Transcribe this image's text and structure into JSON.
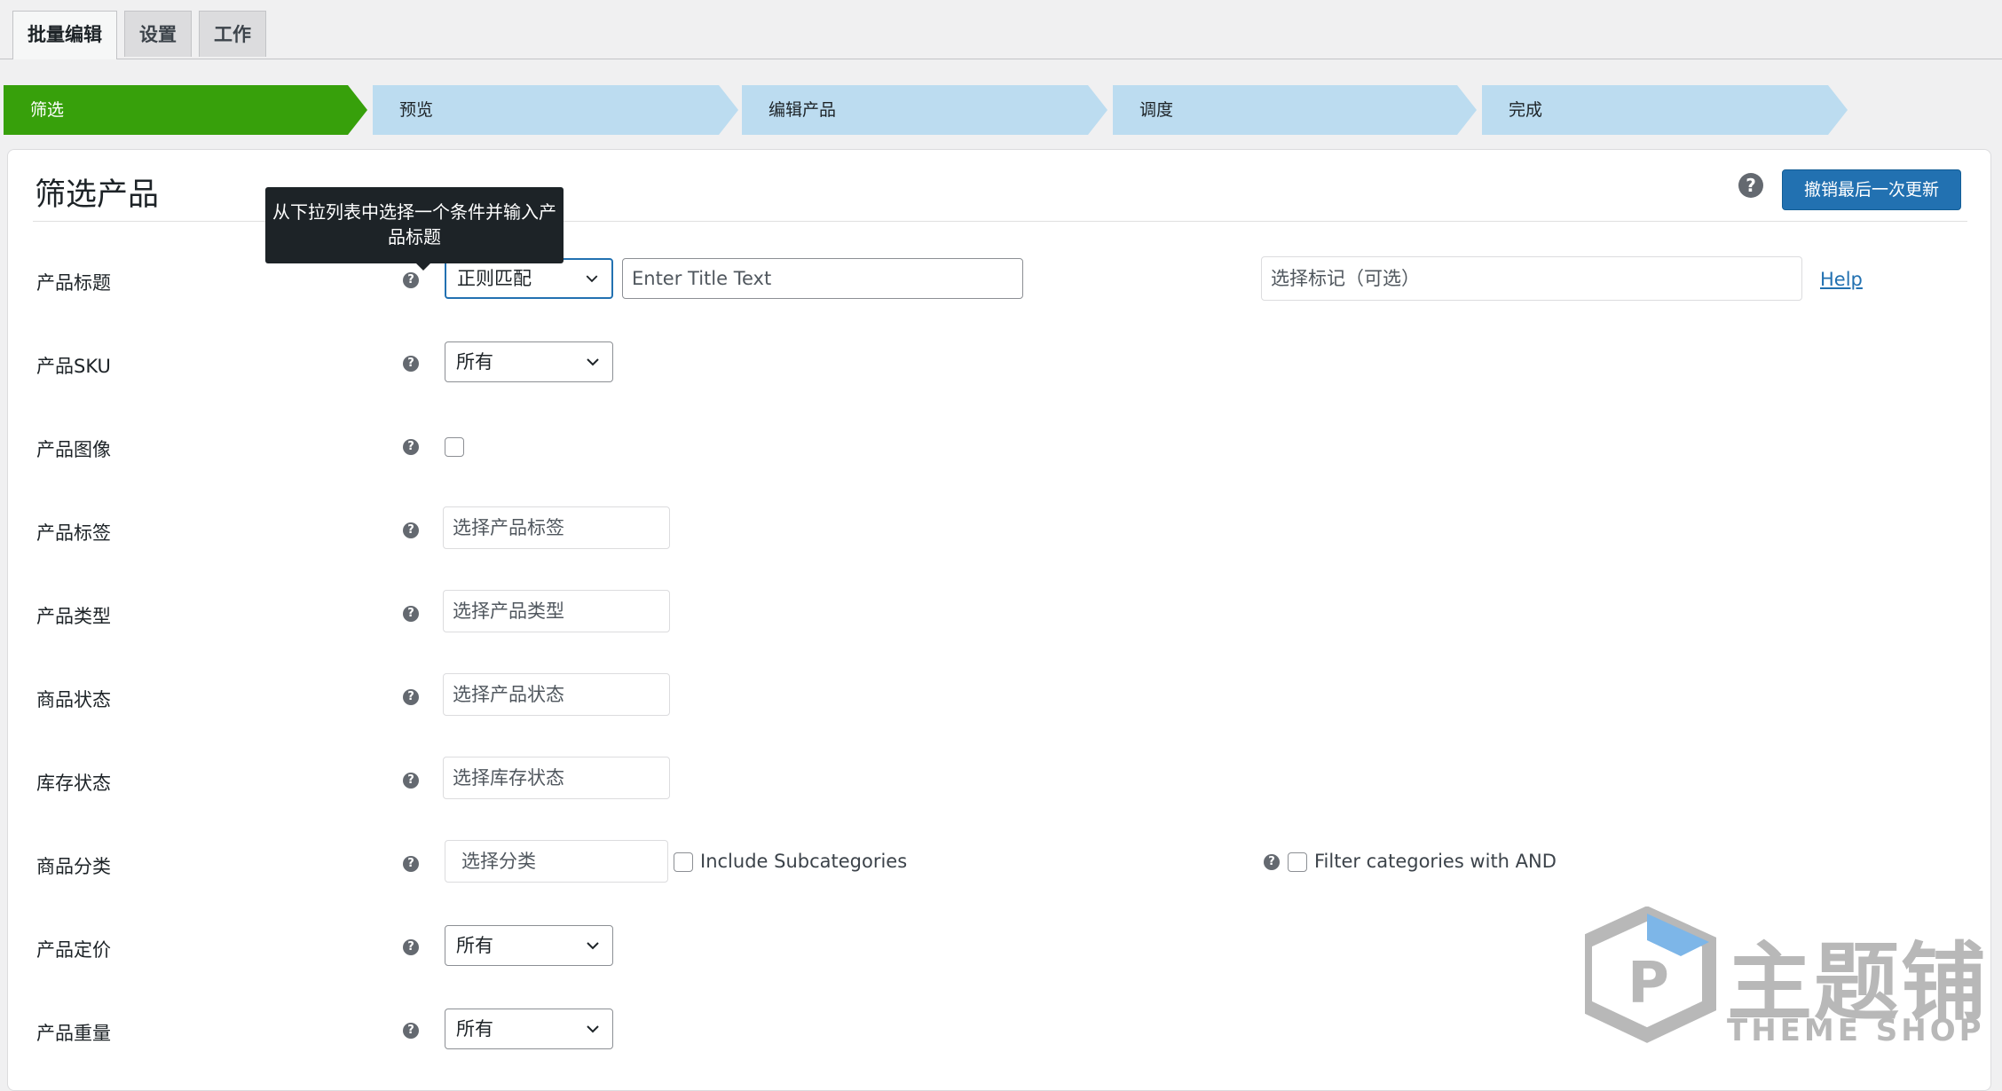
{
  "tabs": [
    {
      "label": "批量编辑",
      "active": true
    },
    {
      "label": "设置",
      "active": false
    },
    {
      "label": "工作",
      "active": false
    }
  ],
  "steps": [
    {
      "label": "筛选",
      "active": true
    },
    {
      "label": "预览",
      "active": false
    },
    {
      "label": "编辑产品",
      "active": false
    },
    {
      "label": "调度",
      "active": false
    },
    {
      "label": "完成",
      "active": false
    }
  ],
  "colors": {
    "step_active": "#37a00b",
    "step_inactive": "#bcdcf0",
    "primary": "#2271b1"
  },
  "panel": {
    "title": "筛选产品",
    "help_icon": "?",
    "undo_button": "撤销最后一次更新",
    "tooltip": "从下拉列表中选择一个条件并输入产品标题"
  },
  "filters": {
    "title": {
      "label": "产品标题",
      "select": "正则匹配",
      "placeholder": "Enter Title Text",
      "tags_placeholder": "选择标记（可选）",
      "help_link": "Help"
    },
    "sku": {
      "label": "产品SKU",
      "select": "所有"
    },
    "image": {
      "label": "产品图像"
    },
    "tags": {
      "label": "产品标签",
      "placeholder": "选择产品标签"
    },
    "type": {
      "label": "产品类型",
      "placeholder": "选择产品类型"
    },
    "status": {
      "label": "商品状态",
      "placeholder": "选择产品状态"
    },
    "stock": {
      "label": "库存状态",
      "placeholder": "选择库存状态"
    },
    "category": {
      "label": "商品分类",
      "placeholder": "选择分类",
      "include_sub": "Include Subcategories",
      "and_filter": "Filter categories with AND"
    },
    "price": {
      "label": "产品定价",
      "select": "所有"
    },
    "weight": {
      "label": "产品重量",
      "select": "所有"
    }
  },
  "watermark": {
    "cn": "主题铺",
    "en": "THEME SHOP"
  }
}
